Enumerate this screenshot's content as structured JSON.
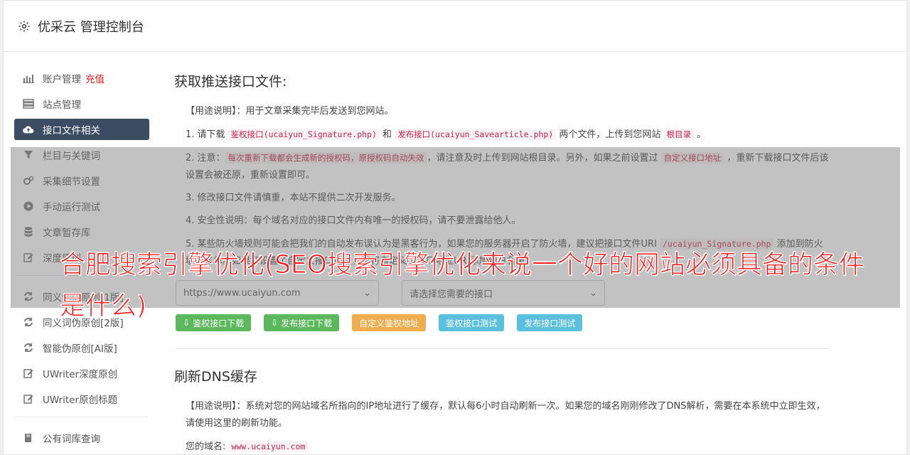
{
  "header": {
    "title": "优采云 管理控制台",
    "icon": "gear-icon"
  },
  "sidebar": {
    "items": [
      {
        "label": "账户管理",
        "badge": "充值",
        "icon": "bar-chart-icon"
      },
      {
        "label": "站点管理",
        "icon": "server-icon"
      },
      {
        "label": "接口文件相关",
        "icon": "cloud-upload-icon",
        "active": true
      },
      {
        "label": "栏目与关键词",
        "icon": "filter-icon"
      },
      {
        "label": "采集细节设置",
        "icon": "cogs-icon"
      },
      {
        "label": "手动运行测试",
        "icon": "play-circle-icon"
      },
      {
        "label": "文章暂存库",
        "icon": "database-icon"
      },
      {
        "label": "深度原创",
        "icon": "edit-icon"
      }
    ],
    "items2": [
      {
        "label": "同义词伪原创[1版]",
        "icon": "refresh-icon"
      },
      {
        "label": "同义词伪原创[2版]",
        "icon": "refresh-icon"
      },
      {
        "label": "智能伪原创[AI版]",
        "icon": "refresh-icon"
      },
      {
        "label": "UWriter深度原创",
        "icon": "edit-icon"
      },
      {
        "label": "UWriter原创标题",
        "icon": "edit-icon"
      }
    ],
    "items3": [
      {
        "label": "公有词库查询",
        "icon": "book-icon"
      }
    ]
  },
  "section1": {
    "title": "获取推送接口文件:",
    "usage_label": "【用途说明】",
    "usage_text": "：用于文章采集完毕后发送到您网站。",
    "p1": {
      "a": "1. 请下载 ",
      "code1": "鉴权接口(ucaiyun_Signature.php)",
      "b": " 和 ",
      "code2": "发布接口(ucaiyun_Savearticle.php)",
      "c": " 两个文件，上传到您网站 ",
      "code3": "根目录",
      "d": " 。"
    },
    "p2": {
      "a": "2. 注意：",
      "code1": "每次重新下载都会生成新的授权码，原授权码自动失效",
      "b": "，请注意及时上传到网站根目录。另外，如果之前设置过 ",
      "code2": "自定义接口地址",
      "c": " ，重新下载接口文件后该设置会被还原，重新设置即可。"
    },
    "p3": "3. 修改接口文件请慎重，本站不提供二次开发服务。",
    "p4": "4. 安全性说明：每个域名对应的接口文件内有唯一的授权码，请不要泄露给他人。",
    "p5": {
      "a": "5. 某些防火墙规则可能会把我们的自动发布误认为是黑客行为，如果您的服务器开启了防火墙，建议把接口文件URI ",
      "code1": "/ucaiyun_Signature.php",
      "b": " 添加到防火墙白名单。如果您设置了自定义接口地址，请将自定义的接口地址URI添加到白名单。"
    },
    "select_site": "https://www.ucaiyun.com",
    "select_iface": "请选择您需要的接口",
    "buttons": [
      "鉴权接口下载",
      "发布接口下载",
      "自定义鉴权地址",
      "鉴权接口测试",
      "发布接口测试"
    ]
  },
  "section2": {
    "title": "刷新DNS缓存",
    "usage_label": "【用途说明】",
    "usage_text": "：系统对您的网站域名所指向的IP地址进行了缓存，默认每6小时自动刷新一次。如果您的域名刚刚修改了DNS解析，需要在本系统中立即生效，请使用这里的刷新功能。",
    "domain_label": "您的域名: ",
    "domain_value": "www.ucaiyun.com"
  },
  "overlay_caption": "合肥搜索引擎优化(SEO搜索引擎优化来说一个好的网站必须具备的条件是什么)",
  "colors": {
    "active_nav": "#3b4c63",
    "green": "#5cb85c",
    "orange": "#f0ad4e",
    "blue": "#5bc0de",
    "caption": "#ff1a1a"
  }
}
